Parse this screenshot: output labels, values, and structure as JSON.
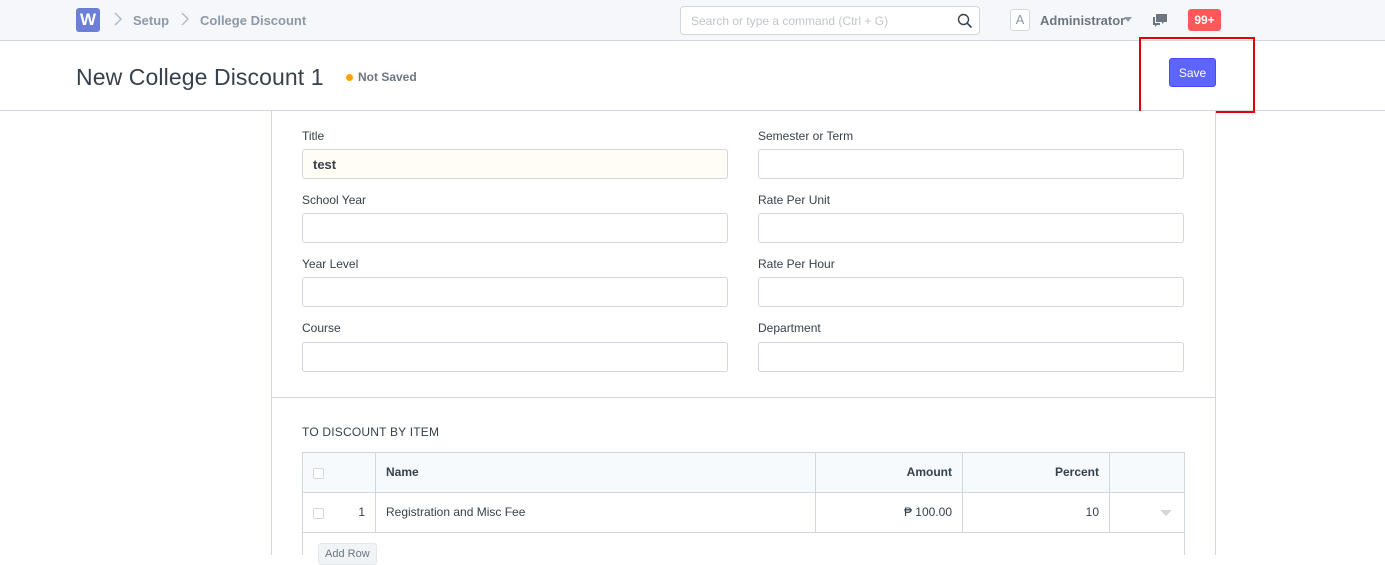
{
  "navbar": {
    "logo_letter": "W",
    "breadcrumbs": [
      "Setup",
      "College Discount"
    ],
    "search_placeholder": "Search or type a command (Ctrl + G)",
    "avatar_letter": "A",
    "user_name": "Administrator",
    "notifications": "99+"
  },
  "page": {
    "title": "New College Discount 1",
    "status": "Not Saved",
    "status_color": "#ffa00a",
    "save_label": "Save",
    "accent": "#5e64ff",
    "highlight_color": "#e0000e"
  },
  "form": {
    "fields": [
      {
        "label": "Title",
        "value": "test"
      },
      {
        "label": "Semester or Term",
        "value": ""
      },
      {
        "label": "School Year",
        "value": ""
      },
      {
        "label": "Rate Per Unit",
        "value": ""
      },
      {
        "label": "Year Level",
        "value": ""
      },
      {
        "label": "Rate Per Hour",
        "value": ""
      },
      {
        "label": "Course",
        "value": ""
      },
      {
        "label": "Department",
        "value": ""
      }
    ]
  },
  "discount_table": {
    "section_title": "TO DISCOUNT BY ITEM",
    "headers": {
      "name": "Name",
      "amount": "Amount",
      "percent": "Percent"
    },
    "rows": [
      {
        "index": "1",
        "name": "Registration and Misc Fee",
        "amount": "₱ 100.00",
        "percent": "10"
      }
    ],
    "add_row_label": "Add Row"
  }
}
